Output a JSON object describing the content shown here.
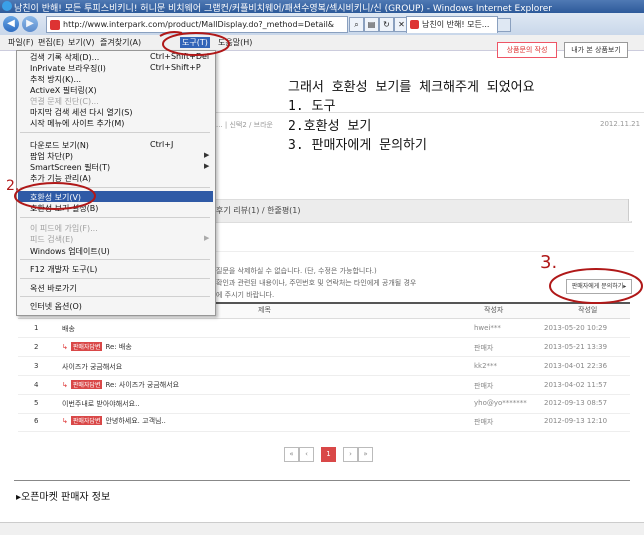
{
  "window": {
    "title": "남친이 반해! 모든 투피스비키니! 허니문 비치웨어 그랩컨/커플비치웨어/패션수영복/섹시비키니/신 (GROUP) - Windows Internet Explorer"
  },
  "address_bar": {
    "url": "http://www.interpark.com/product/MallDisplay.do?_method=Detail&",
    "tab_label": "남친이 반해! 모든..."
  },
  "menu_bar": [
    "파일(F)",
    "편집(E)",
    "보기(V)",
    "즐겨찾기(A)",
    "도구(T)",
    "도움말(H)"
  ],
  "tools_menu": {
    "items": [
      {
        "label": "검색 기록 삭제(D)...",
        "shortcut": "Ctrl+Shift+Del"
      },
      {
        "label": "InPrivate 브라우징(I)",
        "shortcut": "Ctrl+Shift+P"
      },
      {
        "label": "추적 방지(K)..."
      },
      {
        "label": "ActiveX 필터링(X)"
      },
      {
        "label": "연결 문제 진단(C)...",
        "disabled": true
      },
      {
        "label": "마지막 검색 세션 다시 열기(S)"
      },
      {
        "label": "시작 메뉴에 사이트 추가(M)"
      },
      {
        "label": "다운로드 보기(N)",
        "shortcut": "Ctrl+J"
      },
      {
        "label": "팝업 차단(P)",
        "submenu": true
      },
      {
        "label": "SmartScreen 필터(T)",
        "submenu": true
      },
      {
        "label": "추가 기능 관리(A)"
      },
      {
        "label": "호환성 보기(V)",
        "highlighted": true
      },
      {
        "label": "호환성 보기 설정(B)"
      },
      {
        "label": "이 피드에 가입(F)...",
        "disabled": true
      },
      {
        "label": "피드 검색(E)",
        "disabled": true,
        "submenu": true
      },
      {
        "label": "Windows 업데이트(U)"
      },
      {
        "label": "F12 개발자 도구(L)"
      },
      {
        "label": "옥션 바로가기"
      },
      {
        "label": "인터넷 옵션(O)"
      }
    ]
  },
  "page": {
    "btn_inquiry_top": "상품문의 작성",
    "btn_other_products": "내가 본 상품보기",
    "breadcrumb": "... | 신택2 / 브라운",
    "breadcrumb_date": "2012.11.21",
    "review_tab": "후기 리뷰(1) / 한줄평(1)",
    "notice_line1": "질문을 삭제하실 수 없습니다. (단, 수정은 가능합니다.)",
    "notice_line2": "확인과 관련된 내용이나, 주민번호 및 연락처는 타인에게 공개될 경우",
    "notice_line3": "에 주시기 바랍니다.",
    "ask_seller_button": "판매자에게 문의하기▸",
    "table": {
      "headers": [
        "제목",
        "작성자",
        "작성일"
      ],
      "rows": [
        {
          "no": "1",
          "reply": false,
          "title": "배송",
          "author": "hwei***",
          "date": "2013-05-20 10:29"
        },
        {
          "no": "2",
          "reply": true,
          "badge": "판매자답변",
          "title": "Re: 배송",
          "author": "판매자",
          "date": "2013-05-21 13:39"
        },
        {
          "no": "3",
          "reply": false,
          "title": "사이즈가 궁금해서요",
          "author": "kk2***",
          "date": "2013-04-01 22:36"
        },
        {
          "no": "4",
          "reply": true,
          "badge": "판매자답변",
          "title": "Re: 사이즈가 궁금해서요",
          "author": "판매자",
          "date": "2013-04-02 11:57"
        },
        {
          "no": "5",
          "reply": false,
          "title": "이번주내로 받아야해서요..",
          "author": "yho@yo*******",
          "date": "2012-09-13 08:57"
        },
        {
          "no": "6",
          "reply": true,
          "badge": "판매자답변",
          "title": "안녕하세요. 고객님..",
          "author": "판매자",
          "date": "2012-09-13 12:10"
        }
      ]
    },
    "pagination": {
      "first": "«",
      "prev": "‹",
      "current": "1",
      "next": "›",
      "last": "»"
    },
    "seller_section_title": "▸오픈마켓 판매자 정보"
  },
  "annotation": {
    "line0": "그래서 호환성 보기를 체크해주게 되었어요",
    "line1": "1. 도구",
    "line2": "2.호환성 보기",
    "line3": "3. 판매자에게 문의하기",
    "mark2": "2.",
    "mark3": "3."
  },
  "colors": {
    "annotation_red": "#b01818",
    "menu_highlight": "#2f5aa6",
    "badge_red": "#d94848"
  }
}
